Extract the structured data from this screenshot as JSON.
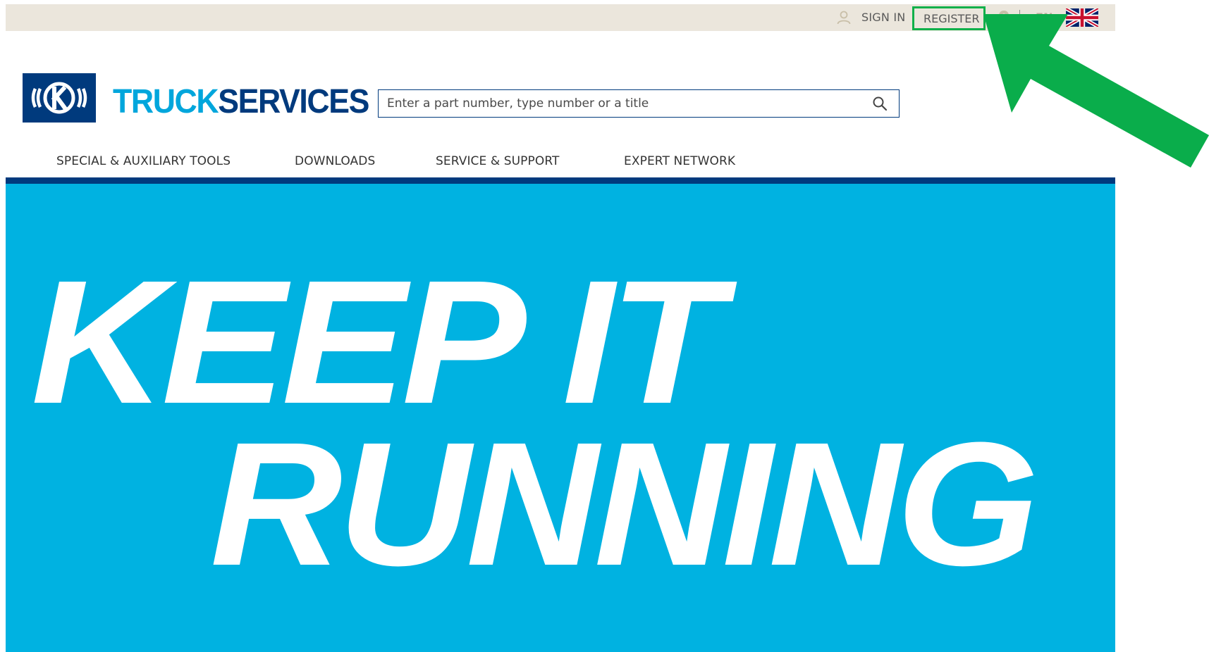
{
  "topbar": {
    "signin_label": "SIGN IN",
    "register_label": "REGISTER",
    "language": "EN",
    "icons": [
      "user-icon",
      "location-pin-icon",
      "uk-flag-icon"
    ]
  },
  "header": {
    "brand_part1": "TRUCK",
    "brand_part2": "SERVICES",
    "logo_icon": "knorr-bremse-logo",
    "search": {
      "placeholder": "Enter a part number, type number or a title",
      "value": ""
    }
  },
  "nav": {
    "items": [
      {
        "label": "SPECIAL & AUXILIARY TOOLS"
      },
      {
        "label": "DOWNLOADS"
      },
      {
        "label": "SERVICE & SUPPORT"
      },
      {
        "label": "EXPERT NETWORK"
      }
    ]
  },
  "hero": {
    "line1": "KEEP IT",
    "line2": "RUNNING"
  },
  "colors": {
    "brand_dark": "#003a7d",
    "brand_light": "#00a6dc",
    "hero_bg": "#00b2e1",
    "topbar_bg": "#ebe6dc",
    "highlight_green": "#10b04a"
  }
}
